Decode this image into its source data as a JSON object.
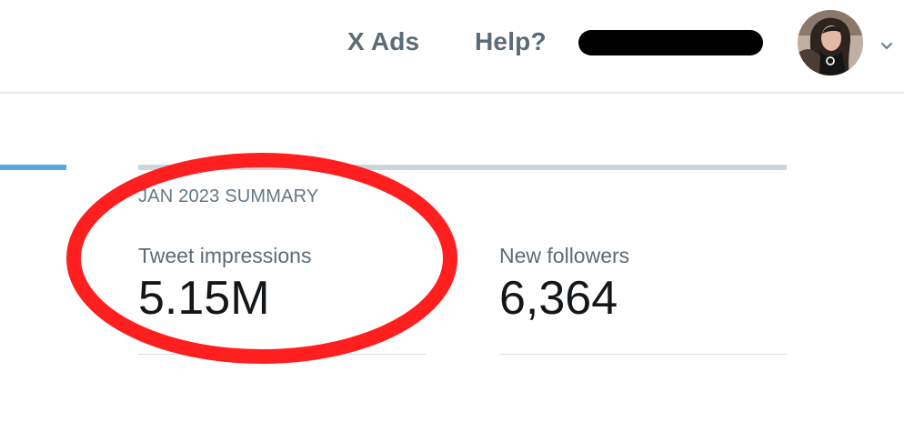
{
  "header": {
    "nav_links": {
      "ads": "X Ads",
      "help": "Help?"
    }
  },
  "summary": {
    "title": "JAN 2023 SUMMARY",
    "metrics": [
      {
        "label": "Tweet impressions",
        "value": "5.15M"
      },
      {
        "label": "New followers",
        "value": "6,364"
      }
    ]
  },
  "colors": {
    "accent_tab": "#5aa8e0",
    "annotation": "#ff1f1f",
    "nav_text": "#5b6b78",
    "redaction": "#000000"
  },
  "icons": {
    "avatar": "user-avatar",
    "chevron": "chevron-down-icon"
  }
}
